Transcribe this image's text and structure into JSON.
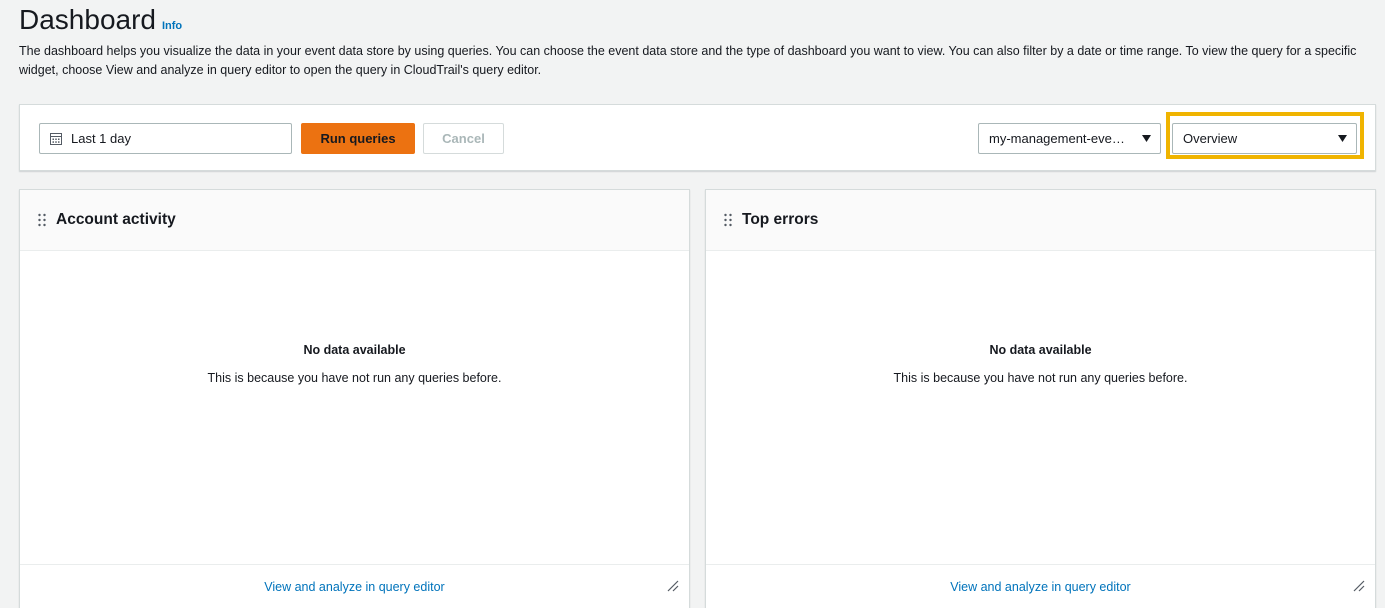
{
  "header": {
    "title": "Dashboard",
    "info_label": "Info",
    "description": "The dashboard helps you visualize the data in your event data store by using queries. You can choose the event data store and the type of dashboard you want to view. You can also filter by a date or time range. To view the query for a specific widget, choose View and analyze in query editor to open the query in CloudTrail's query editor."
  },
  "toolbar": {
    "date_range_value": "Last 1 day",
    "run_label": "Run queries",
    "cancel_label": "Cancel",
    "event_data_store_value": "my-management-eve…",
    "dashboard_type_value": "Overview",
    "accent_color": "#ec7211",
    "highlight_color": "#f0b400"
  },
  "panels": [
    {
      "title": "Account activity",
      "empty_title": "No data available",
      "empty_message": "This is because you have not run any queries before.",
      "footer_link": "View and analyze in query editor"
    },
    {
      "title": "Top errors",
      "empty_title": "No data available",
      "empty_message": "This is because you have not run any queries before.",
      "footer_link": "View and analyze in query editor"
    }
  ],
  "icons": {
    "calendar": "calendar-icon",
    "caret": "caret-down-icon",
    "drag": "drag-handle-icon",
    "resize": "resize-handle-icon"
  }
}
